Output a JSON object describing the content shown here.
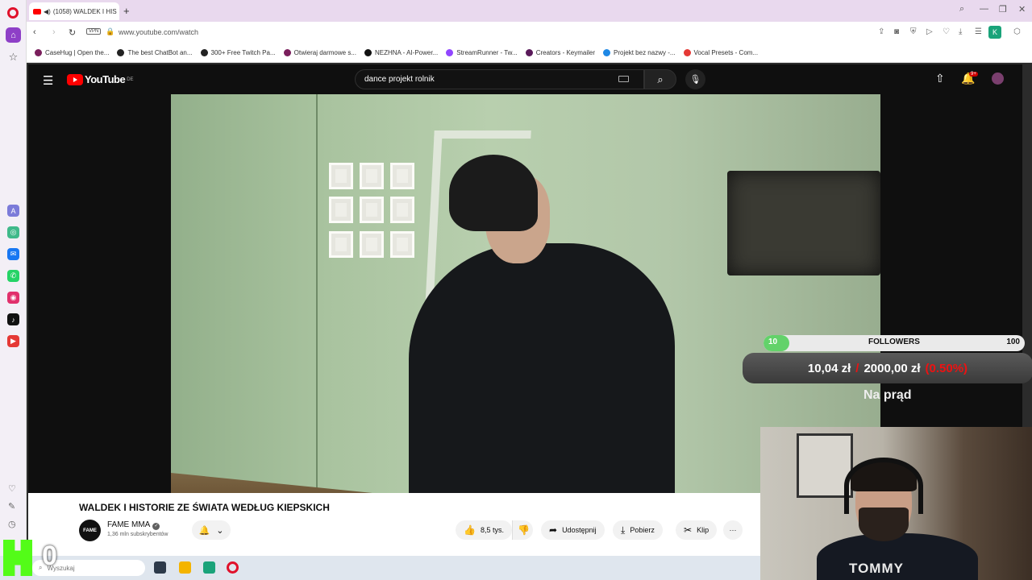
{
  "browser": {
    "tab_title": "(1058) WALDEK I HIS",
    "new_tab_icon": "plus-icon",
    "url": "www.youtube.com/watch",
    "vpn_label": "VPN",
    "profile_initial": "K",
    "bookmarks": [
      {
        "label": "CaseHug | Open the...",
        "color": "#7a1f5c"
      },
      {
        "label": "The best ChatBot an...",
        "color": "#222222"
      },
      {
        "label": "300+ Free Twitch Pa...",
        "color": "#222222"
      },
      {
        "label": "Otwieraj darmowe s...",
        "color": "#7a1f5c"
      },
      {
        "label": "NEZHNA - AI-Power...",
        "color": "#111111"
      },
      {
        "label": "StreamRunner - Tw...",
        "color": "#9146ff"
      },
      {
        "label": "Creators - Keymailer",
        "color": "#5a1a5a"
      },
      {
        "label": "Projekt bez nazwy -...",
        "color": "#1e88e5"
      },
      {
        "label": "Vocal Presets - Com...",
        "color": "#e53935"
      }
    ]
  },
  "youtube": {
    "logo_text": "YouTube",
    "logo_region": "DE",
    "search_query": "dance projekt rolnik",
    "notification_badge": "9+",
    "video": {
      "title": "WALDEK I HISTORIE ZE ŚWIATA WEDŁUG KIEPSKICH",
      "channel": "FAME MMA",
      "channel_avatar_text": "FAME",
      "subscribers": "1,36 mln subskrybentów",
      "likes": "8,5 tys.",
      "share_label": "Udostępnij",
      "download_label": "Pobierz",
      "clip_label": "Klip"
    }
  },
  "overlay": {
    "followers_current": "10",
    "followers_label": "FOLLOWERS",
    "followers_goal": "100",
    "followers_fraction": 0.1,
    "donation_current": "10,04 zł",
    "donation_separator": "/",
    "donation_goal": "2000,00 zł",
    "donation_percent": "(0.50%)",
    "goal_name": "Na prąd"
  },
  "webcam": {
    "shirt_brand": "TOMMY"
  },
  "taskbar": {
    "search_placeholder": "Wyszukaj",
    "kick_count": "0"
  },
  "colors": {
    "youtube_red": "#ff0000",
    "opera_red": "#e0112b",
    "opera_purple": "#8e3fc7",
    "kick_green": "#53fc18",
    "progress_green": "#63d26a"
  }
}
